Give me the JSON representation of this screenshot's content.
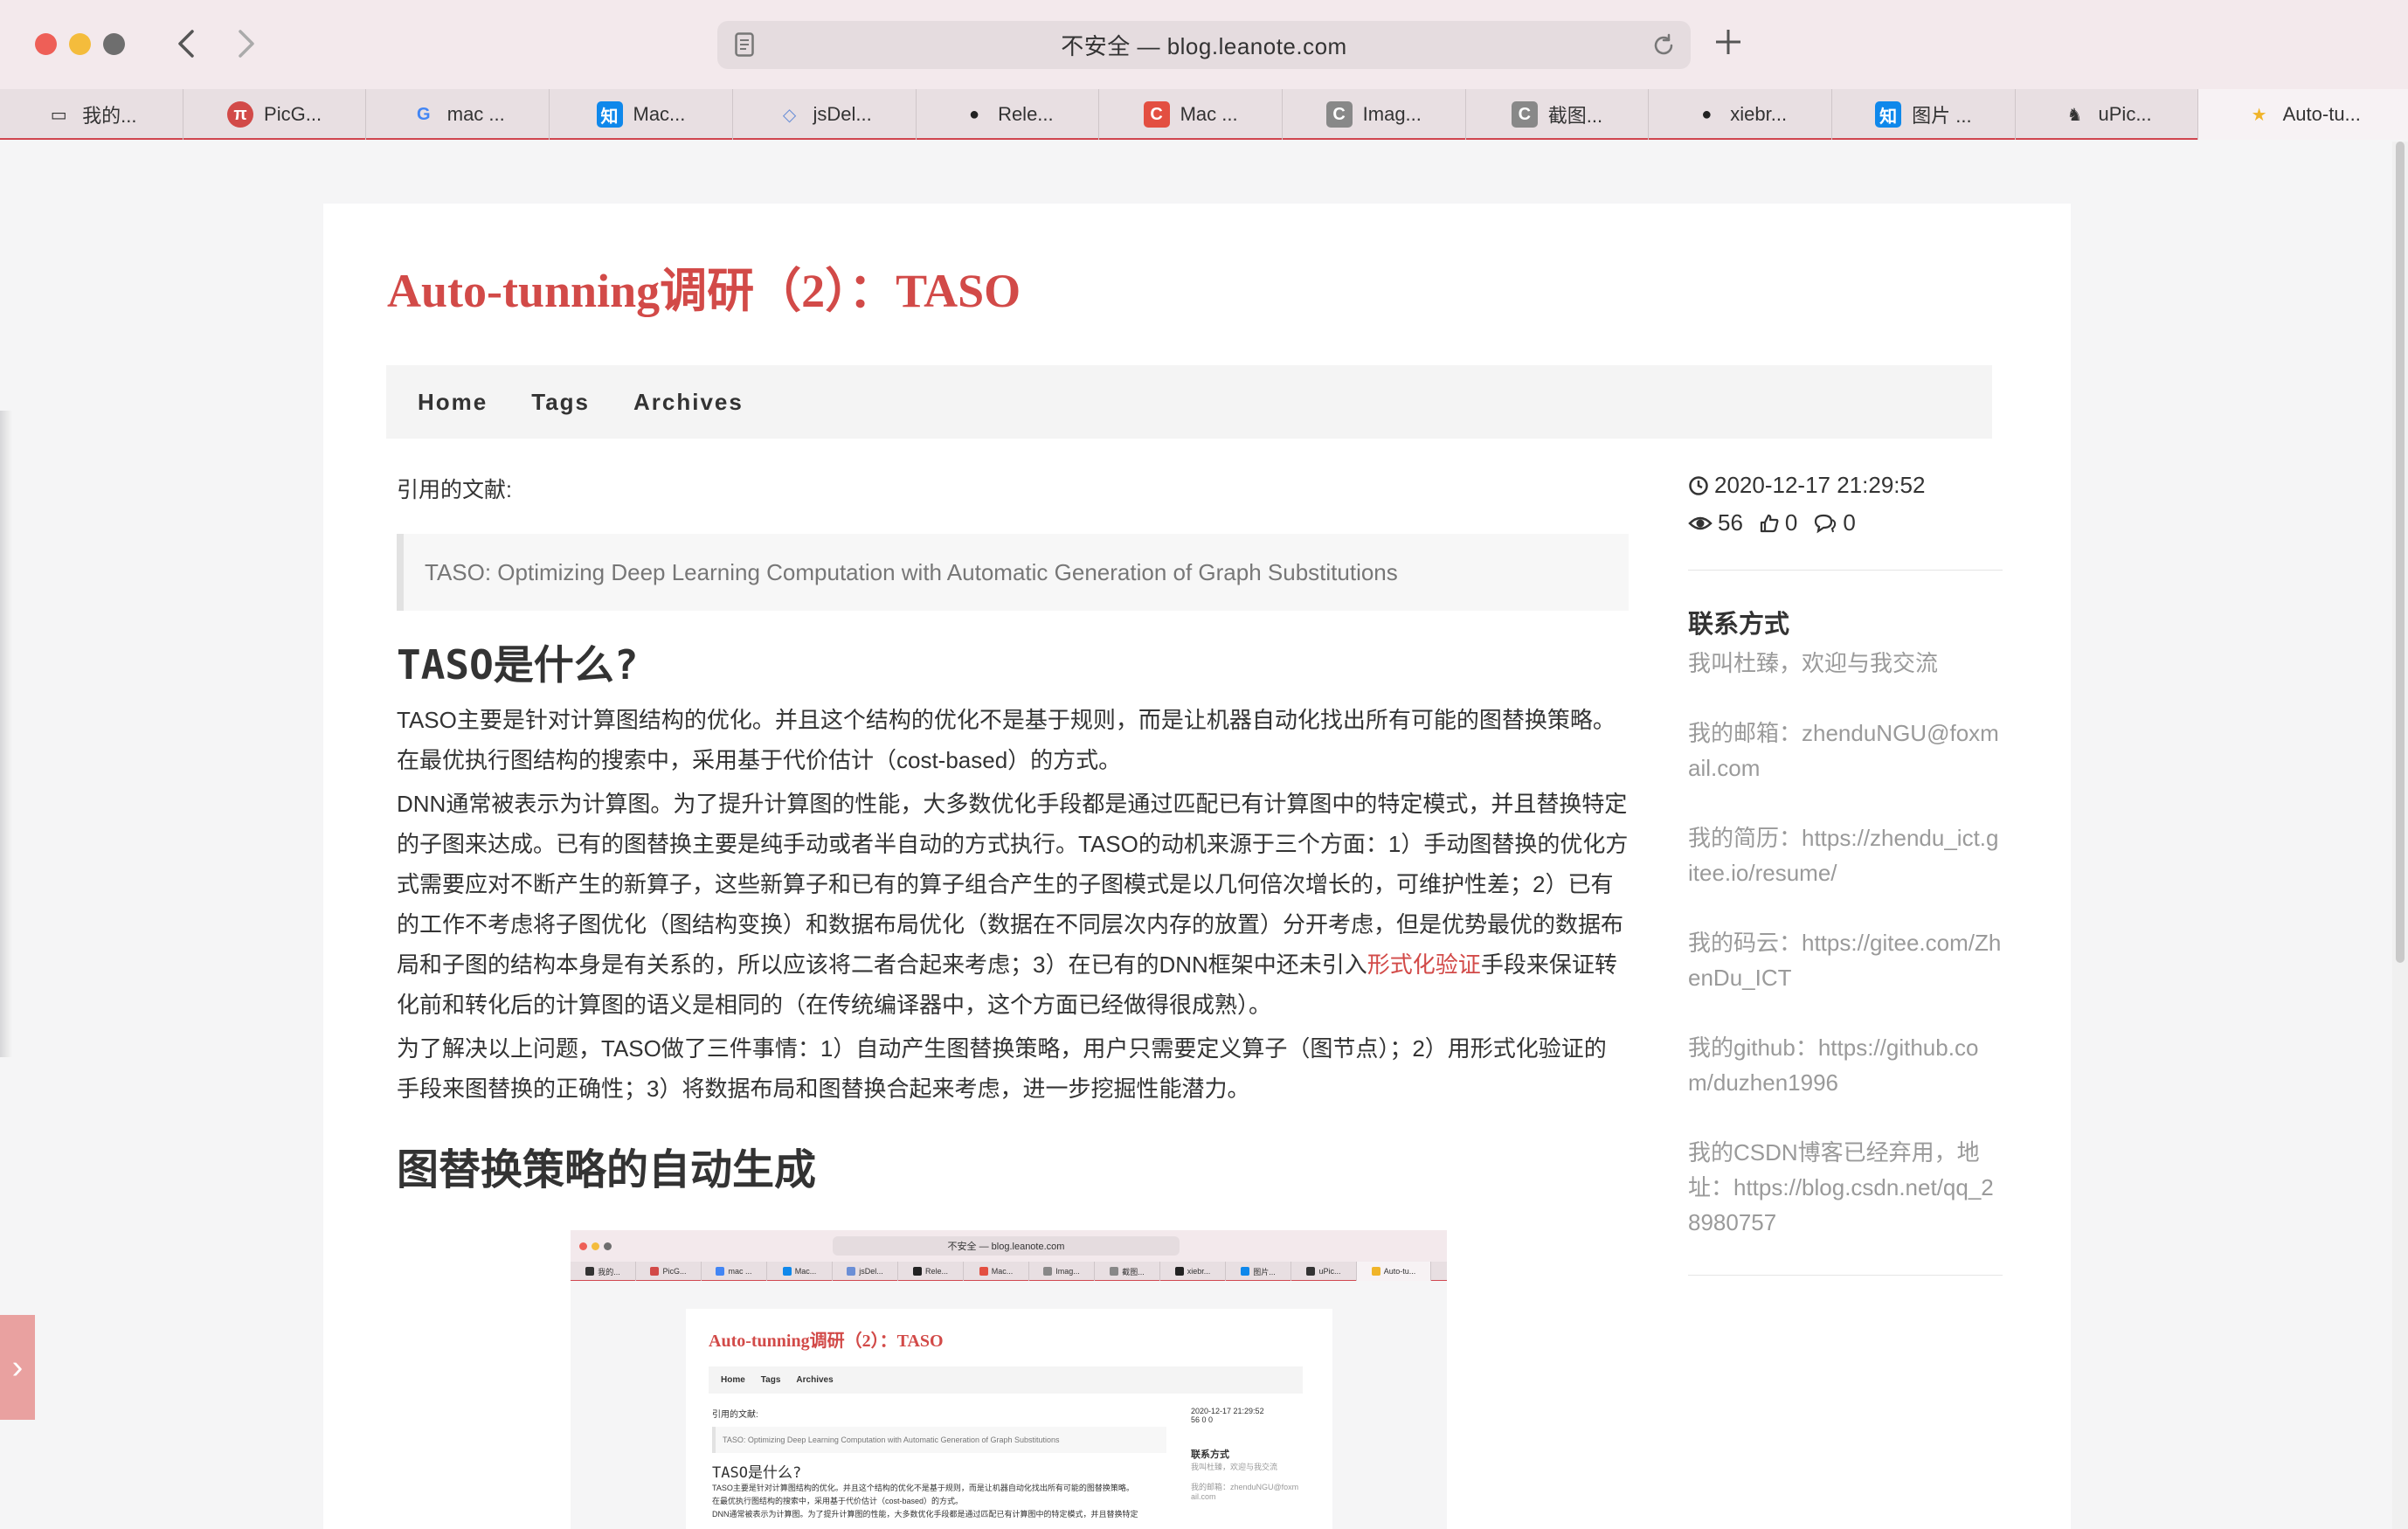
{
  "browser": {
    "url": "不安全 — blog.leanote.com",
    "tabs": [
      {
        "label": "我的...",
        "icon": "bookmark-icon",
        "color": "#333333"
      },
      {
        "label": "PicG...",
        "icon": "picgo-icon",
        "color": "#d24a48"
      },
      {
        "label": "mac ...",
        "icon": "google-icon",
        "color": "#4285f4"
      },
      {
        "label": "Mac...",
        "icon": "zhihu-icon",
        "color": "#0f88eb"
      },
      {
        "label": "jsDel...",
        "icon": "jsdelivr-icon",
        "color": "#6b8fd6"
      },
      {
        "label": "Rele...",
        "icon": "github-icon",
        "color": "#222222"
      },
      {
        "label": "Mac ...",
        "icon": "csdn-icon",
        "color": "#e34f41"
      },
      {
        "label": "Imag...",
        "icon": "c-icon",
        "color": "#888888"
      },
      {
        "label": "截图...",
        "icon": "c-icon",
        "color": "#888888"
      },
      {
        "label": "xiebr...",
        "icon": "github-icon",
        "color": "#222222"
      },
      {
        "label": "图片 ...",
        "icon": "zhihu-icon",
        "color": "#0f88eb"
      },
      {
        "label": "uPic...",
        "icon": "upic-icon",
        "color": "#333333"
      },
      {
        "label": "Auto-tu...",
        "icon": "star-icon",
        "color": "#f0b429"
      }
    ]
  },
  "blog": {
    "title": "Auto-tunning调研（2）：TASO",
    "menu": [
      "Home",
      "Tags",
      "Archives"
    ]
  },
  "article": {
    "cite_label": "引用的文献:",
    "quote": "TASO: Optimizing Deep Learning Computation with Automatic Generation of Graph Substitutions",
    "heading1": "TASO是什么?",
    "para1": "TASO主要是针对计算图结构的优化。并且这个结构的优化不是基于规则，而是让机器自动化找出所有可能的图替换策略。在最优执行图结构的搜索中，采用基于代价估计（cost-based）的方式。",
    "para2_before": "DNN通常被表示为计算图。为了提升计算图的性能，大多数优化手段都是通过匹配已有计算图中的特定模式，并且替换特定的子图来达成。已有的图替换主要是纯手动或者半自动的方式执行。TASO的动机来源于三个方面：1）手动图替换的优化方式需要应对不断产生的新算子，这些新算子和已有的算子组合产生的子图模式是以几何倍次增长的，可维护性差；2）已有的工作不考虑将子图优化（图结构变换）和数据布局优化（数据在不同层次内存的放置）分开考虑，但是优势最优的数据布局和子图的结构本身是有关系的，所以应该将二者合起来考虑；3）在已有的DNN框架中还未引入",
    "para2_link": "形式化验证",
    "para2_after": "手段来保证转化前和转化后的计算图的语义是相同的（在传统编译器中，这个方面已经做得很成熟）。",
    "para3": "为了解决以上问题，TASO做了三件事情：1）自动产生图替换策略，用户只需要定义算子（图节点）；2）用形式化验证的手段来图替换的正确性；3）将数据布局和图替换合起来考虑，进一步挖掘性能潜力。",
    "heading2": "图替换策略的自动生成"
  },
  "embedded_screenshot": {
    "url": "不安全 — blog.leanote.com",
    "tabs": [
      "我的...",
      "PicG...",
      "mac ...",
      "Mac...",
      "jsDel...",
      "Rele...",
      "Mac...",
      "Imag...",
      "截图...",
      "xiebr...",
      "图片...",
      "uPic...",
      "Auto-tu..."
    ],
    "title": "Auto-tunning调研（2）：TASO",
    "menu": [
      "Home",
      "Tags",
      "Archives"
    ],
    "cite_label": "引用的文献:",
    "quote": "TASO: Optimizing Deep Learning Computation with Automatic Generation of Graph Substitutions",
    "heading": "TASO是什么?",
    "line1": "TASO主要是针对计算图结构的优化。并且这个结构的优化不是基于规则，而是让机器自动化找出所有可能的图替换策略。",
    "line2": "在最优执行图结构的搜索中，采用基于代价估计（cost-based）的方式。",
    "line3": "DNN通常被表示为计算图。为了提升计算图的性能，大多数优化手段都是通过匹配已有计算图中的特定模式，并且替换特定",
    "date": "2020-12-17 21:29:52",
    "stats": "56  0  0",
    "contact_title": "联系方式",
    "contact_intro": "我叫杜臻，欢迎与我交流",
    "email_1": "我的邮箱：zhenduNGU@foxm",
    "email_2": "ail.com"
  },
  "sidebar": {
    "date": "2020-12-17 21:29:52",
    "views": "56",
    "likes": "0",
    "comments": "0",
    "contact_title": "联系方式",
    "contact_intro": "我叫杜臻，欢迎与我交流",
    "email": "我的邮箱：zhenduNGU@foxmail.com",
    "resume": "我的简历：https://zhendu_ict.gitee.io/resume/",
    "gitee": "我的码云：https://gitee.com/ZhenDu_ICT",
    "github": "我的github：https://github.com/duzhen1996",
    "csdn": "我的CSDN博客已经弃用，地址：https://blog.csdn.net/qq_28980757"
  },
  "colors": {
    "accent": "#d24a48",
    "muted_text": "#9a9a9a",
    "side_toggle": "#e9a1a0"
  }
}
